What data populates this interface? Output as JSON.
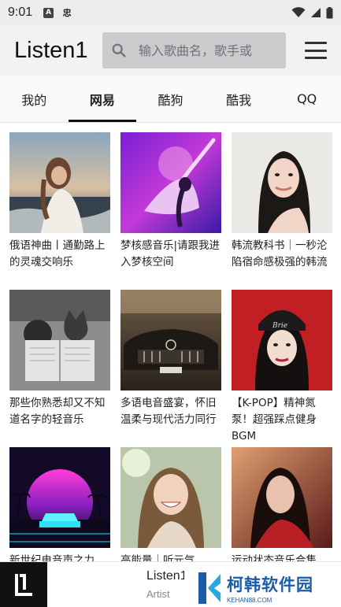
{
  "status_bar": {
    "time": "9:01",
    "icons": [
      "notification-a-icon",
      "app-notification-icon",
      "wifi-icon",
      "signal-icon",
      "battery-icon"
    ],
    "sq_letter": "A",
    "app_glyph": "忠"
  },
  "app_bar": {
    "title": "Listen1",
    "search_placeholder": "输入歌曲名，歌手或",
    "menu_icon": "hamburger-menu-icon"
  },
  "tabs": [
    {
      "label": "我的",
      "active": false
    },
    {
      "label": "网易",
      "active": true
    },
    {
      "label": "酷狗",
      "active": false
    },
    {
      "label": "酷我",
      "active": false
    },
    {
      "label": "QQ",
      "active": false
    }
  ],
  "playlists": [
    {
      "title": "俄语神曲丨通勤路上的灵魂交响乐",
      "art": "girl-by-sea"
    },
    {
      "title": "梦核感音乐|请跟我进入梦核空间",
      "art": "dancer-in-purple"
    },
    {
      "title": "韩流教科书｜一秒沦陷宿命感极强的韩流",
      "art": "korean-woman-portrait"
    },
    {
      "title": "那些你熟悉却又不知道名字的轻音乐",
      "art": "child-and-cat-reading"
    },
    {
      "title": "多语电音盛宴，怀旧温柔与现代活力同行",
      "art": "vintage-mercedes"
    },
    {
      "title": "【K-POP】精神氮泵！超强踩点健身BGM",
      "art": "kpop-idol-beanie"
    },
    {
      "title": "新世纪电音声之力",
      "art": "synthwave-car"
    },
    {
      "title": "高能量｜听元气",
      "art": "smiling-girl"
    },
    {
      "title": "运动状态音乐合集",
      "art": "girl-in-red"
    }
  ],
  "player": {
    "title": "Listen1",
    "artist": "Artist"
  },
  "watermark": {
    "name": "柯韩软件园",
    "url": "KEHAN88.COM"
  },
  "colors": {
    "status_bar_bg": "#ececec",
    "app_bar_bg": "#f2f2f2",
    "search_bg": "#c9cbcd",
    "tab_indicator": "#111111",
    "watermark_blue": "#1a5ca8"
  }
}
